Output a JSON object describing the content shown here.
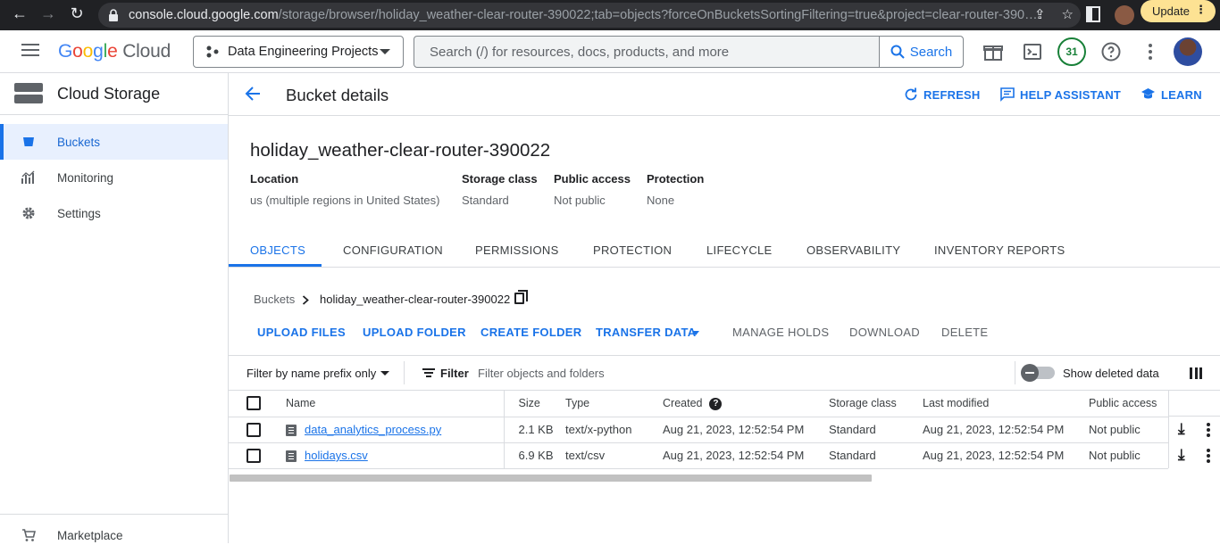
{
  "browser": {
    "url_host": "console.cloud.google.com",
    "url_path": "/storage/browser/holiday_weather-clear-router-390022;tab=objects?forceOnBucketsSortingFiltering=true&project=clear-router-390…",
    "update_label": "Update"
  },
  "header": {
    "logo_google": [
      "G",
      "o",
      "o",
      "g",
      "l",
      "e"
    ],
    "logo_cloud": "Cloud",
    "project": "Data Engineering Projects",
    "search_placeholder": "Search (/) for resources, docs, products, and more",
    "search_button": "Search",
    "notification_count": "31"
  },
  "sidebar": {
    "title": "Cloud Storage",
    "items": [
      {
        "label": "Buckets",
        "icon": "bucket-icon",
        "active": true
      },
      {
        "label": "Monitoring",
        "icon": "chart-icon",
        "active": false
      },
      {
        "label": "Settings",
        "icon": "gear-icon",
        "active": false
      }
    ],
    "marketplace": "Marketplace"
  },
  "page": {
    "title": "Bucket details",
    "actions": [
      "REFRESH",
      "HELP ASSISTANT",
      "LEARN"
    ]
  },
  "bucket": {
    "name": "holiday_weather-clear-router-390022",
    "meta": [
      {
        "label": "Location",
        "value": "us (multiple regions in United States)"
      },
      {
        "label": "Storage class",
        "value": "Standard"
      },
      {
        "label": "Public access",
        "value": "Not public"
      },
      {
        "label": "Protection",
        "value": "None"
      }
    ]
  },
  "tabs": [
    "OBJECTS",
    "CONFIGURATION",
    "PERMISSIONS",
    "PROTECTION",
    "LIFECYCLE",
    "OBSERVABILITY",
    "INVENTORY REPORTS"
  ],
  "breadcrumb": {
    "root": "Buckets",
    "current": "holiday_weather-clear-router-390022"
  },
  "object_actions": [
    "UPLOAD FILES",
    "UPLOAD FOLDER",
    "CREATE FOLDER",
    "TRANSFER DATA",
    "MANAGE HOLDS",
    "DOWNLOAD",
    "DELETE"
  ],
  "filter": {
    "prefix_label": "Filter by name prefix only",
    "filter_label": "Filter",
    "placeholder": "Filter objects and folders",
    "show_deleted": "Show deleted data"
  },
  "table": {
    "columns": [
      "Name",
      "Size",
      "Type",
      "Created",
      "Storage class",
      "Last modified",
      "Public access"
    ],
    "rows": [
      [
        "data_analytics_process.py",
        "2.1 KB",
        "text/x-python",
        "Aug 21, 2023, 12:52:54 PM",
        "Standard",
        "Aug 21, 2023, 12:52:54 PM",
        "Not public"
      ],
      [
        "holidays.csv",
        "6.9 KB",
        "text/csv",
        "Aug 21, 2023, 12:52:54 PM",
        "Standard",
        "Aug 21, 2023, 12:52:54 PM",
        "Not public"
      ]
    ]
  }
}
